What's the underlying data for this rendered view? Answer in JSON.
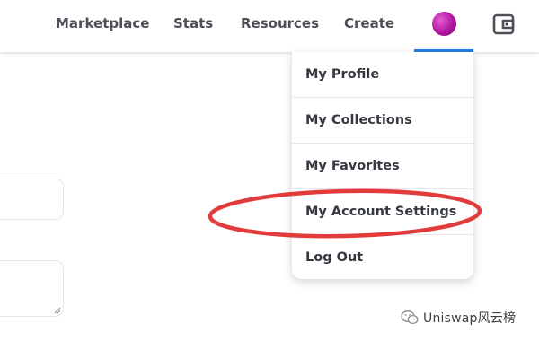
{
  "header": {
    "nav": [
      "Marketplace",
      "Stats",
      "Resources",
      "Create"
    ]
  },
  "dropdown": {
    "items": [
      "My Profile",
      "My Collections",
      "My Favorites",
      "My Account Settings",
      "Log Out"
    ]
  },
  "icons": {
    "avatar": "profile-avatar",
    "wallet": "wallet-icon"
  },
  "annotation": {
    "color": "#e23b3b",
    "target": "My Account Settings"
  },
  "watermark": {
    "text": "Uniswap风云榜"
  },
  "colors": {
    "accent": "#2081e2",
    "nav_text": "#4c4f57",
    "menu_text": "#353840",
    "divider": "#e5e8eb"
  }
}
